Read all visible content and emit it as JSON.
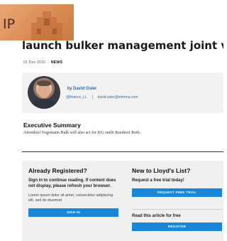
{
  "logo": {
    "text": "IP"
  },
  "article": {
    "headline": "launch bulker management joint venture",
    "date": "01 Dec 2016",
    "category": "NEWS"
  },
  "author": {
    "by_prefix": "by",
    "name": "David Osler",
    "twitter": "@finance_LL",
    "email": "david.osler@informa.com"
  },
  "summary": {
    "title": "Executive Summary",
    "text": "Ahrenkiel Vogemann Bulk will also act for KG outfit Reederei Roth."
  },
  "registered": {
    "title": "Already Registered?",
    "description": "Sign in to continue reading. If content does not display, please refresh your browser.",
    "lorem": "Lorem ipsum dolor sit amet, consectetur adipiscing elit, sed do eiusmod",
    "sign_in_label": "SIGN IN"
  },
  "new_user": {
    "title": "New to Lloyd's List?",
    "trial_text": "Request a free trial today!",
    "trial_button": "REQUEST FREE TRIAL",
    "read_free_text": "Read this article for free",
    "register_button": "REGISTER"
  },
  "colors": {
    "accent": "#1b86d6",
    "link": "#1b6fb8",
    "logo_bg": "#e09a66"
  }
}
